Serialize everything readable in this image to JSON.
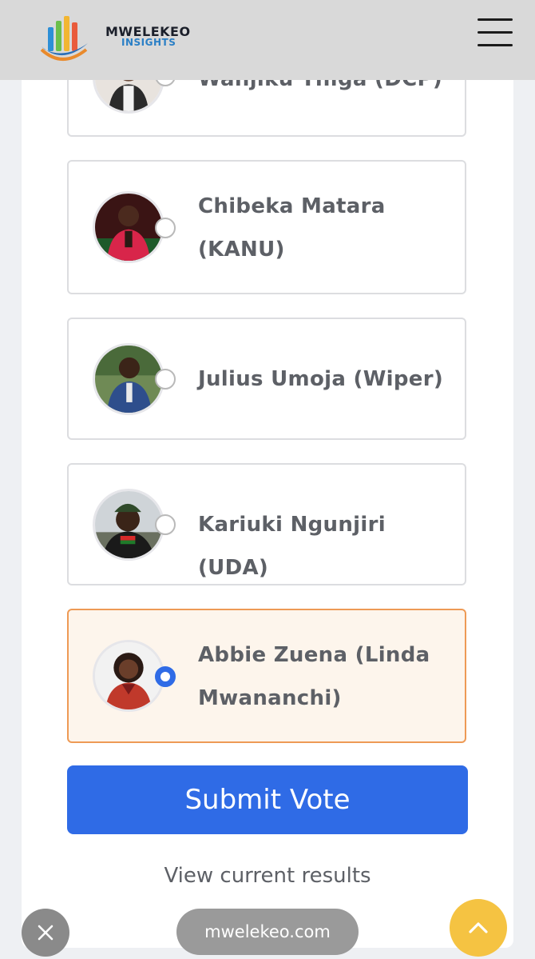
{
  "brand": {
    "name": "MWELEKEO",
    "sub": "INSIGHTS",
    "logo_icon": "bar-chart-swoosh-logo"
  },
  "menu_icon": "hamburger-menu-icon",
  "candidates": [
    {
      "name": "Wanjiku Thiga (DCP)",
      "selected": false
    },
    {
      "name": "Chibeka Matara (KANU)",
      "selected": false
    },
    {
      "name": "Julius Umoja (Wiper)",
      "selected": false
    },
    {
      "name": "Kariuki Ngunjiri (UDA)",
      "selected": false
    },
    {
      "name": "Abbie Zuena (Linda Mwananchi)",
      "selected": true
    }
  ],
  "submit_label": "Submit Vote",
  "results_link": "View current results",
  "browser": {
    "url": "mwelekeo.com",
    "close_icon": "close-icon",
    "scroll_top_icon": "chevron-up-icon"
  },
  "colors": {
    "primary": "#2f6be6",
    "selected_bg": "#fdf5ec",
    "selected_border": "#ee9a55",
    "fab": "#f5c342"
  }
}
